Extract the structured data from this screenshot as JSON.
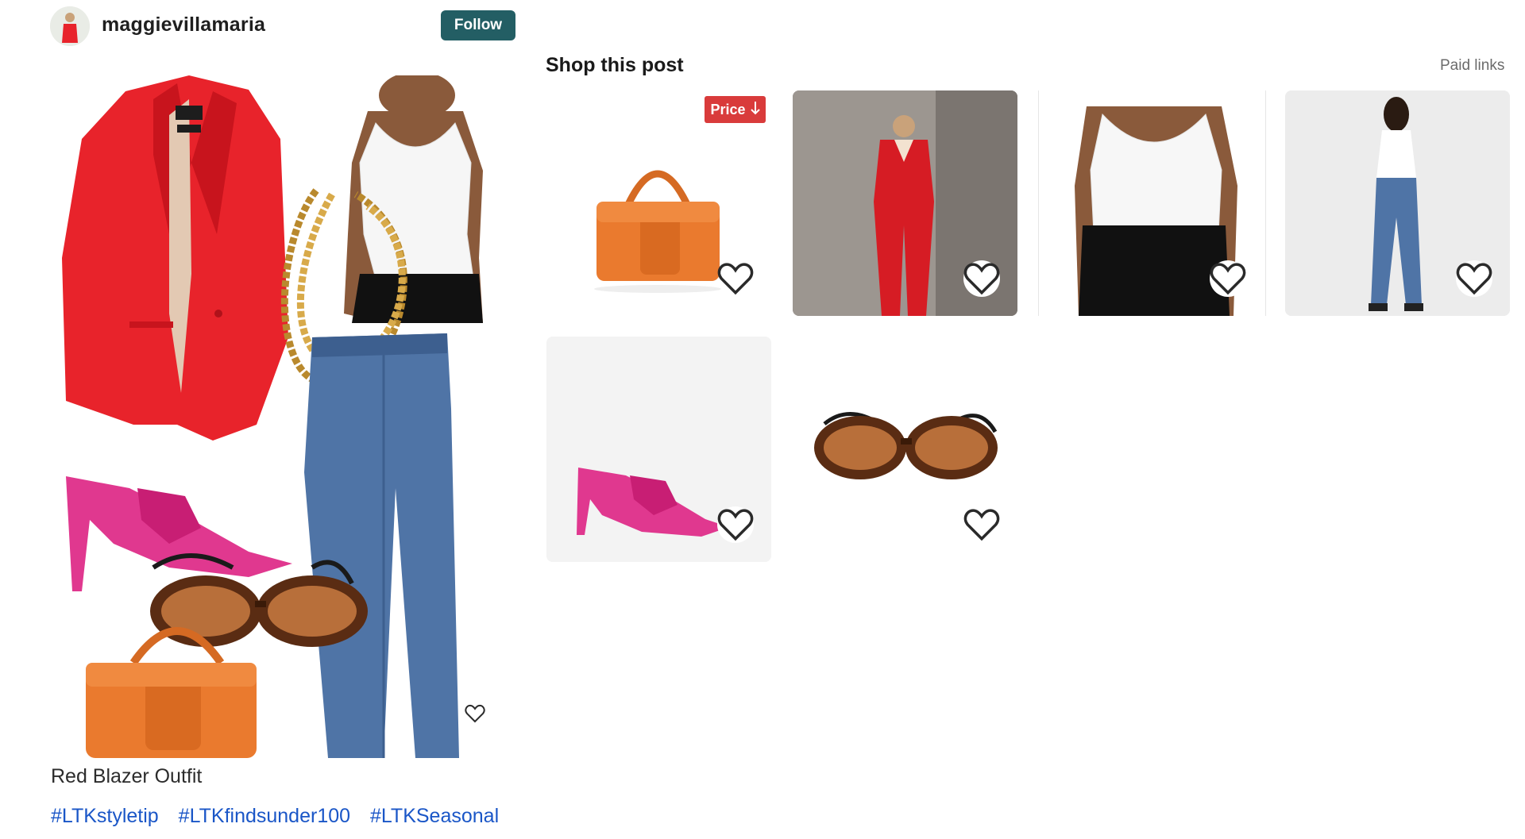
{
  "header": {
    "username": "maggievillamaria",
    "follow_label": "Follow"
  },
  "post": {
    "title": "Red Blazer Outfit",
    "hashtags": [
      "#LTKstyletip",
      "#LTKfindsunder100",
      "#LTKSeasonal"
    ]
  },
  "shop": {
    "title": "Shop this post",
    "paid_links_label": "Paid links",
    "price_badge": "Price",
    "products": [
      {
        "name": "orange mini bag",
        "price_drop": true,
        "favorited_button": "heart-outline"
      },
      {
        "name": "red suit",
        "price_drop": false,
        "favorited_button": "heart-circle"
      },
      {
        "name": "white tank top",
        "price_drop": false,
        "favorited_button": "heart-circle"
      },
      {
        "name": "straight leg jeans",
        "price_drop": false,
        "favorited_button": "heart-circle"
      },
      {
        "name": "pink satin heel",
        "price_drop": false,
        "favorited_button": "heart-circle"
      },
      {
        "name": "tortoise oval sunglasses",
        "price_drop": false,
        "favorited_button": "heart-outline"
      }
    ]
  },
  "icons": {
    "heart": "heart-icon",
    "price_arrow": "arrow-down-icon"
  },
  "colors": {
    "follow_bg": "#235e64",
    "hashtag": "#1a56c7",
    "price_badge": "#d93b3b",
    "blazer_red": "#e8232b",
    "bag_orange": "#ea7a2e",
    "heel_pink": "#e0388f",
    "denim_blue": "#4f74a6"
  }
}
